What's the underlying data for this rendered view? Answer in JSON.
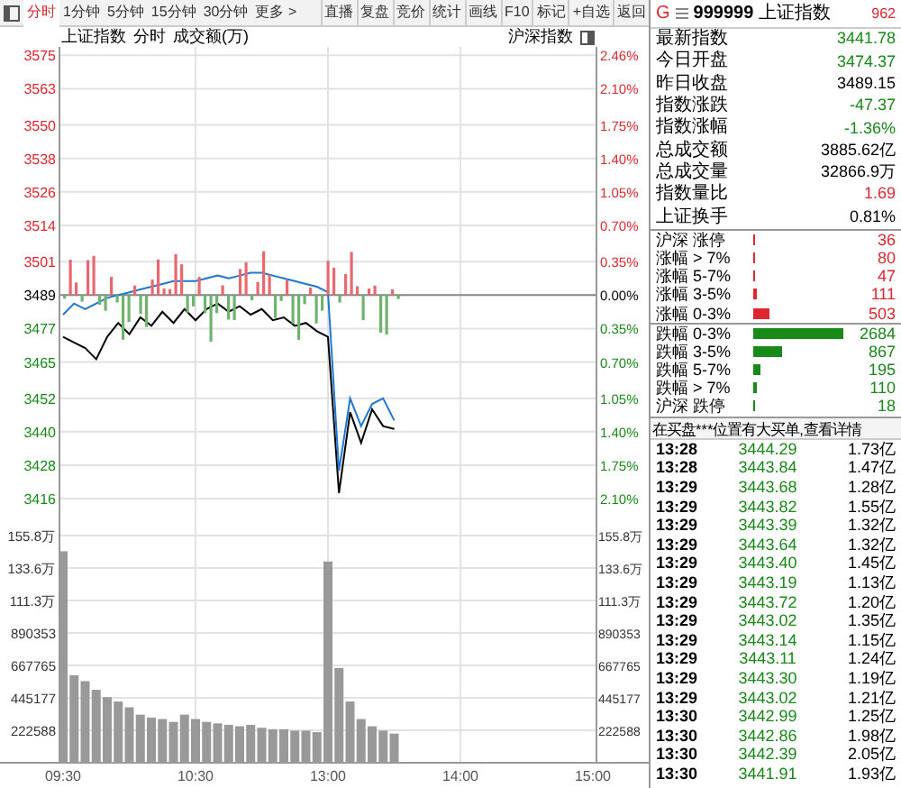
{
  "toolbar": {
    "tabs": [
      {
        "label": "分时",
        "selected": true
      },
      {
        "label": "1分钟",
        "selected": false
      },
      {
        "label": "5分钟",
        "selected": false
      },
      {
        "label": "15分钟",
        "selected": false
      },
      {
        "label": "30分钟",
        "selected": false
      },
      {
        "label": "更多 >",
        "selected": false
      }
    ],
    "buttons": [
      "直播",
      "复盘",
      "竞价",
      "统计",
      "画线",
      "F10",
      "标记",
      "+自选",
      "返回"
    ]
  },
  "chart_header": {
    "title": "上证指数",
    "mode": "分时",
    "measure": "成交额(万)",
    "index_toggle": "沪深指数"
  },
  "price_chart": {
    "chart_data": {
      "type": "line",
      "categories": [
        null,
        null,
        null,
        null,
        null,
        null,
        null,
        null,
        null,
        null,
        null,
        null,
        null,
        null,
        null,
        null,
        null,
        null,
        null,
        null,
        null,
        null,
        null,
        null,
        null,
        null,
        null,
        null,
        null,
        null,
        null,
        null,
        null,
        null,
        null,
        null,
        null,
        null,
        null,
        null,
        null,
        null,
        null,
        null,
        null,
        null,
        null,
        null,
        null
      ],
      "ylim": [
        3406,
        3578
      ],
      "grid": true,
      "ref_lines": [
        {
          "axis": "y",
          "value": 3489
        }
      ],
      "yticks": [
        {
          "value": 3575,
          "label": "3575"
        },
        {
          "value": 3563,
          "label": "3563"
        },
        {
          "value": 3550,
          "label": "3550"
        },
        {
          "value": 3538,
          "label": "3538"
        },
        {
          "value": 3526,
          "label": "3526"
        },
        {
          "value": 3514,
          "label": "3514"
        },
        {
          "value": 3501,
          "label": "3501"
        },
        {
          "value": 3489,
          "label": "3489"
        },
        {
          "value": 3477,
          "label": "3477"
        },
        {
          "value": 3465,
          "label": "3465"
        },
        {
          "value": 3452,
          "label": "3452"
        },
        {
          "value": 3440,
          "label": "3440"
        },
        {
          "value": 3428,
          "label": "3428"
        },
        {
          "value": 3416,
          "label": "3416"
        }
      ],
      "series": [
        {
          "color": "#000000",
          "values": [
            3474,
            3472,
            3470,
            3466,
            3474,
            3479,
            3475,
            3481,
            3478,
            3483,
            3479,
            3484,
            3480,
            3484,
            3486,
            3483,
            3485,
            3482,
            3484,
            3480,
            3481,
            3478,
            3479,
            3476,
            3474,
            3418,
            3447,
            3436,
            3448,
            3442,
            3441,
            null,
            null,
            null,
            null,
            null,
            null,
            null,
            null,
            null,
            null,
            null,
            null,
            null,
            null,
            null,
            null,
            null,
            null
          ]
        },
        {
          "color": "#1e78d2",
          "values": [
            3482,
            3486,
            3484,
            3486,
            3488,
            3489,
            3490,
            3491,
            3492,
            3493,
            3494,
            3494,
            3494,
            3495,
            3496,
            3495,
            3496,
            3497,
            3497,
            3496,
            3495,
            3494,
            3493,
            3492,
            3490,
            3426,
            3452,
            3442,
            3450,
            3452,
            3444,
            null,
            null,
            null,
            null,
            null,
            null,
            null,
            null,
            null,
            null,
            null,
            null,
            null,
            null,
            null,
            null,
            null,
            null
          ]
        }
      ]
    },
    "right_axis": [
      {
        "label": "2.46%",
        "color": "#e0262d"
      },
      {
        "label": "2.10%",
        "color": "#e0262d"
      },
      {
        "label": "1.75%",
        "color": "#e0262d"
      },
      {
        "label": "1.40%",
        "color": "#e0262d"
      },
      {
        "label": "1.05%",
        "color": "#e0262d"
      },
      {
        "label": "0.70%",
        "color": "#e0262d"
      },
      {
        "label": "0.35%",
        "color": "#e0262d"
      },
      {
        "label": "0.00%",
        "color": "#000000"
      },
      {
        "label": "0.35%",
        "color": "#178a17"
      },
      {
        "label": "0.70%",
        "color": "#178a17"
      },
      {
        "label": "1.05%",
        "color": "#178a17"
      },
      {
        "label": "1.40%",
        "color": "#178a17"
      },
      {
        "label": "1.75%",
        "color": "#178a17"
      },
      {
        "label": "2.10%",
        "color": "#178a17"
      }
    ]
  },
  "volume_chart": {
    "chart_data": {
      "type": "bar",
      "grid": true,
      "ylim": [
        0,
        1558000
      ],
      "yticks": [
        {
          "value": 890353,
          "label": "890353"
        },
        {
          "value": 667765,
          "label": "667765"
        },
        {
          "value": 445177,
          "label": "445177"
        },
        {
          "value": 222588,
          "label": "222588"
        }
      ],
      "categories": [
        "09:30",
        null,
        null,
        null,
        null,
        null,
        null,
        null,
        null,
        null,
        null,
        null,
        "10:30",
        null,
        null,
        null,
        null,
        null,
        null,
        null,
        null,
        null,
        null,
        null,
        "13:00",
        null,
        null,
        null,
        null,
        null,
        null,
        null,
        null,
        null,
        null,
        null,
        "14:00",
        null,
        null,
        null,
        null,
        null,
        null,
        null,
        null,
        null,
        null,
        null,
        "15:00"
      ],
      "series": [
        {
          "color": "#999999",
          "values": [
            1450000,
            600000,
            560000,
            500000,
            450000,
            420000,
            380000,
            330000,
            310000,
            300000,
            280000,
            330000,
            300000,
            280000,
            270000,
            260000,
            250000,
            260000,
            240000,
            230000,
            230000,
            220000,
            220000,
            210000,
            1380000,
            650000,
            420000,
            300000,
            250000,
            220000,
            200000,
            null,
            null,
            null,
            null,
            null,
            null,
            null,
            null,
            null,
            null,
            null,
            null,
            null,
            null,
            null,
            null,
            null,
            null
          ]
        }
      ]
    },
    "upper_axis_labels": [
      "155.8万",
      "133.6万",
      "111.3万"
    ],
    "right_axis": [
      "155.8万",
      "133.6万",
      "111.3万",
      "890353",
      "667765",
      "445177",
      "222588"
    ]
  },
  "quote": {
    "prefix": "G",
    "code": "999999",
    "name": "上证指数",
    "badge": "962",
    "stats": [
      {
        "label": "最新指数",
        "value": "3441.78",
        "color": "#178a17"
      },
      {
        "label": "今日开盘",
        "value": "3474.37",
        "color": "#178a17"
      },
      {
        "label": "昨日收盘",
        "value": "3489.15",
        "color": "#000000"
      },
      {
        "label": "指数涨跌",
        "value": "-47.37",
        "color": "#178a17"
      },
      {
        "label": "指数涨幅",
        "value": "-1.36%",
        "color": "#178a17"
      },
      {
        "label": "总成交额",
        "value": "3885.62亿",
        "color": "#000000"
      },
      {
        "label": "总成交量",
        "value": "32866.9万",
        "color": "#000000"
      },
      {
        "label": "指数量比",
        "value": "1.69",
        "color": "#e0262d"
      },
      {
        "label": "上证换手",
        "value": "0.81%",
        "color": "#000000"
      }
    ],
    "breadth_groups": [
      [
        {
          "label": "沪深 涨停",
          "count": "36",
          "color": "#e0262d"
        },
        {
          "label": "涨幅 > 7%",
          "count": "80",
          "color": "#e0262d"
        },
        {
          "label": "涨幅 5-7%",
          "count": "47",
          "color": "#e0262d"
        },
        {
          "label": "涨幅 3-5%",
          "count": "111",
          "color": "#e0262d"
        },
        {
          "label": "涨幅 0-3%",
          "count": "503",
          "color": "#e0262d"
        }
      ],
      [
        {
          "label": "跌幅 0-3%",
          "count": "2684",
          "color": "#178a17"
        },
        {
          "label": "跌幅 3-5%",
          "count": "867",
          "color": "#178a17"
        },
        {
          "label": "跌幅 5-7%",
          "count": "195",
          "color": "#178a17"
        },
        {
          "label": "跌幅 > 7%",
          "count": "110",
          "color": "#178a17"
        },
        {
          "label": "沪深 跌停",
          "count": "18",
          "color": "#178a17"
        }
      ]
    ],
    "ticks_notice": "在买盘***位置有大买单,查看详情",
    "ticks": [
      {
        "time": "13:28",
        "price": "3444.29",
        "amount": "1.73亿"
      },
      {
        "time": "13:28",
        "price": "3443.84",
        "amount": "1.47亿"
      },
      {
        "time": "13:29",
        "price": "3443.68",
        "amount": "1.28亿"
      },
      {
        "time": "13:29",
        "price": "3443.82",
        "amount": "1.55亿"
      },
      {
        "time": "13:29",
        "price": "3443.39",
        "amount": "1.32亿"
      },
      {
        "time": "13:29",
        "price": "3443.64",
        "amount": "1.32亿"
      },
      {
        "time": "13:29",
        "price": "3443.40",
        "amount": "1.45亿"
      },
      {
        "time": "13:29",
        "price": "3443.19",
        "amount": "1.13亿"
      },
      {
        "time": "13:29",
        "price": "3443.72",
        "amount": "1.20亿"
      },
      {
        "time": "13:29",
        "price": "3443.02",
        "amount": "1.35亿"
      },
      {
        "time": "13:29",
        "price": "3443.14",
        "amount": "1.15亿"
      },
      {
        "time": "13:29",
        "price": "3443.11",
        "amount": "1.24亿"
      },
      {
        "time": "13:29",
        "price": "3443.30",
        "amount": "1.19亿"
      },
      {
        "time": "13:29",
        "price": "3443.02",
        "amount": "1.21亿"
      },
      {
        "time": "13:30",
        "price": "3442.99",
        "amount": "1.25亿"
      },
      {
        "time": "13:30",
        "price": "3442.86",
        "amount": "1.98亿"
      },
      {
        "time": "13:30",
        "price": "3442.39",
        "amount": "2.05亿"
      },
      {
        "time": "13:30",
        "price": "3441.91",
        "amount": "1.93亿"
      }
    ]
  }
}
